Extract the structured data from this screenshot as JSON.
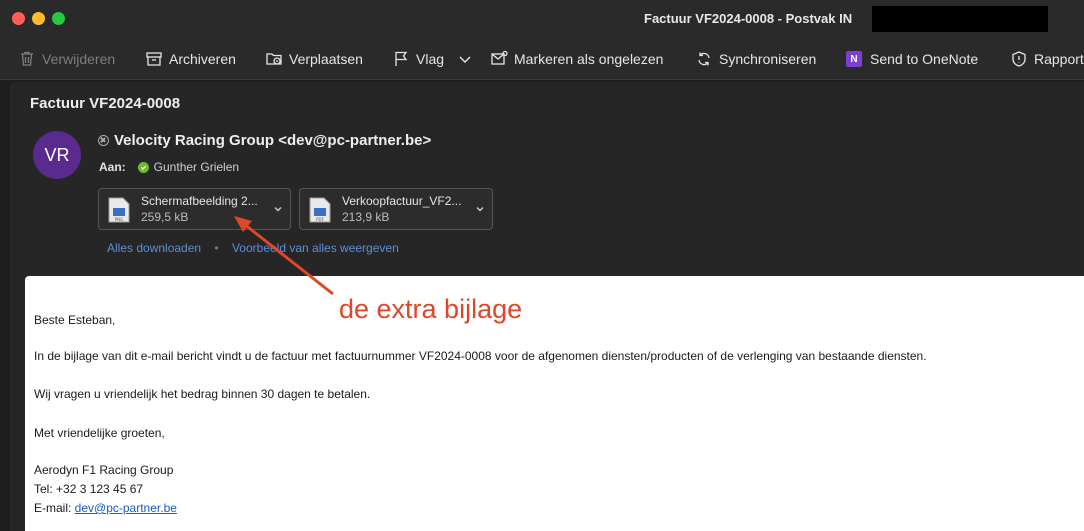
{
  "window": {
    "title": "Factuur VF2024-0008 - Postvak IN"
  },
  "toolbar": {
    "delete": "Verwijderen",
    "archive": "Archiveren",
    "move": "Verplaatsen",
    "flag": "Vlag",
    "mark_unread": "Markeren als ongelezen",
    "sync": "Synchroniseren",
    "onenote": "Send to OneNote",
    "onenote_badge": "N",
    "report": "Rapport"
  },
  "message": {
    "subject": "Factuur VF2024-0008",
    "avatar_initials": "VR",
    "sender": "Velocity Racing Group <dev@pc-partner.be>",
    "to_label": "Aan:",
    "to_name": "Gunther Grielen",
    "attachments": [
      {
        "name": "Schermafbeelding 2...",
        "size": "259,5 kB"
      },
      {
        "name": "Verkoopfactuur_VF2...",
        "size": "213,9 kB"
      }
    ],
    "download_all": "Alles downloaden",
    "link_separator": "•",
    "preview_all": "Voorbeeld van alles weergeven"
  },
  "body": {
    "greeting": "Beste Esteban,",
    "para1": "In de bijlage van dit e-mail bericht vindt u de factuur met factuurnummer VF2024-0008 voor de afgenomen diensten/producten of de verlenging van bestaande diensten.",
    "para2": "Wij vragen u vriendelijk het bedrag binnen 30 dagen te betalen.",
    "closing": "Met vriendelijke groeten,",
    "company": "Aerodyn F1 Racing Group",
    "tel": "Tel: +32 3 123 45 67",
    "email_label": "E-mail: ",
    "email_link": "dev@pc-partner.be"
  },
  "annotation": {
    "text": "de extra bijlage",
    "color": "#e0462a"
  },
  "colors": {
    "accent_link": "#5d8fd6",
    "avatar": "#5a2a8e",
    "presence": "#6cbb2c",
    "onenote": "#7d3ed1"
  }
}
